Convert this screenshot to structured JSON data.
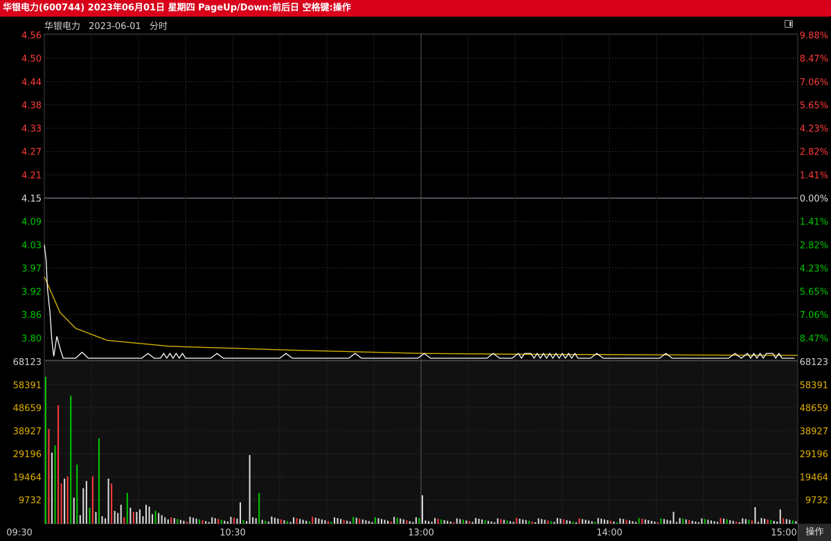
{
  "window": {
    "title": "华银电力(600744) 2023年06月01日 星期四 PageUp/Down:前后日 空格键:操作"
  },
  "header": {
    "stock_name": "华银电力",
    "date": "2023-06-01",
    "mode": "分时"
  },
  "footer": {
    "operate_label": "操作"
  },
  "colors": {
    "title_bar": "#d8001a",
    "up": "#ff3b3b",
    "down": "#00c800",
    "neutral": "#dcdcdc",
    "avg_line": "#d4b000",
    "price_line": "#ffffff"
  },
  "chart_data": {
    "type": "line",
    "time_ticks": [
      "09:30",
      "10:30",
      "13:00",
      "14:00",
      "15:00"
    ],
    "price_axis": {
      "labels": [
        "4.56",
        "4.50",
        "4.44",
        "4.38",
        "4.33",
        "4.27",
        "4.21",
        "4.15",
        "4.09",
        "4.03",
        "3.97",
        "3.92",
        "3.86",
        "3.80"
      ],
      "prev_close": 4.15,
      "range": [
        3.74,
        4.56
      ]
    },
    "percent_axis": {
      "labels": [
        "9.88%",
        "8.47%",
        "7.06%",
        "5.65%",
        "4.23%",
        "2.82%",
        "1.41%",
        "0.00%",
        "1.41%",
        "2.82%",
        "4.23%",
        "5.65%",
        "7.06%",
        "8.47%"
      ]
    },
    "volume_axis": {
      "labels": [
        "68123",
        "58391",
        "48659",
        "38927",
        "29196",
        "19464",
        "9732"
      ],
      "max": 68123
    },
    "series": [
      {
        "name": "price",
        "description_points": [
          [
            0,
            4.03
          ],
          [
            1,
            3.9
          ],
          [
            3,
            3.75
          ],
          [
            4,
            3.79
          ],
          [
            5,
            3.77
          ],
          [
            6,
            3.74
          ],
          [
            10,
            3.76
          ],
          [
            12,
            3.74
          ],
          [
            60,
            3.74
          ],
          [
            70,
            3.75
          ],
          [
            80,
            3.74
          ],
          [
            240,
            3.74
          ]
        ]
      },
      {
        "name": "avg",
        "description_points": [
          [
            0,
            3.95
          ],
          [
            5,
            3.86
          ],
          [
            10,
            3.82
          ],
          [
            20,
            3.79
          ],
          [
            40,
            3.775
          ],
          [
            80,
            3.765
          ],
          [
            120,
            3.757
          ],
          [
            150,
            3.755
          ],
          [
            240,
            3.752
          ]
        ]
      }
    ]
  }
}
